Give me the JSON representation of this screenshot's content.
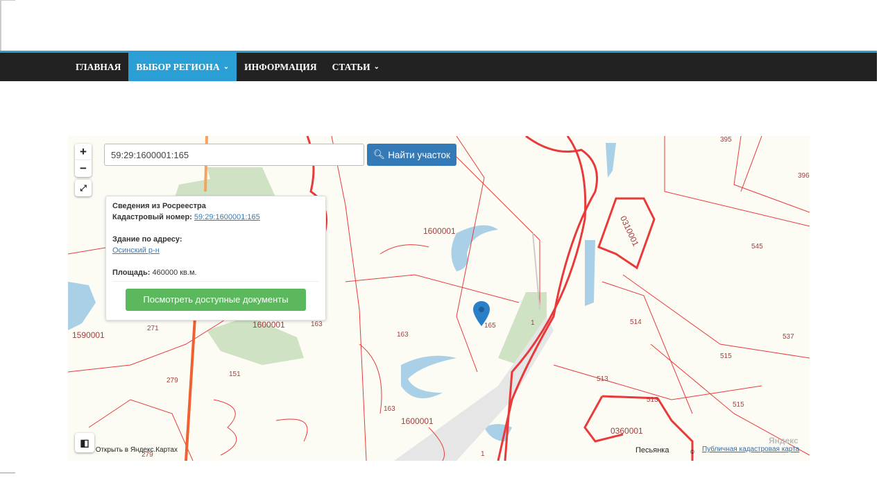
{
  "nav": {
    "items": [
      {
        "label": "ГЛАВНАЯ"
      },
      {
        "label": "ВЫБОР РЕГИОНА",
        "dropdown": true,
        "active": true
      },
      {
        "label": "ИНФОРМАЦИЯ"
      },
      {
        "label": "СТАТЬИ",
        "dropdown": true
      }
    ]
  },
  "map": {
    "search_value": "59:29:1600001:165",
    "find_button": "Найти участок",
    "zoom_in": "+",
    "zoom_out": "−",
    "popup": {
      "title": "Сведения из Росреестра",
      "cadastral_label": "Кадастровый номер:",
      "cadastral_value": "59:29:1600001:165",
      "address_label": "Здание по адресу:",
      "address_value": "Осинский р-н",
      "area_label": "Площадь:",
      "area_value": "460000 кв.м.",
      "docs_button": "Посмотреть доступные документы"
    },
    "labels": [
      "1600001",
      "1600001",
      "1600001",
      "1590001",
      "0310001",
      "0360001",
      "271",
      "279",
      "151",
      "163",
      "163",
      "163",
      "165",
      "1",
      "1",
      "395",
      "396",
      "545",
      "514",
      "537",
      "515",
      "515",
      "513",
      "513",
      "279"
    ],
    "place": "Песьянка",
    "open_yandex": "Открыть в Яндекс.Картах",
    "public_map_link": "Публичная кадастровая карта",
    "yandex_logo": "Яндекс",
    "colors": {
      "boundary": "#e83a3a",
      "water": "#a9d0e6",
      "forest": "#cfe3c4",
      "accent": "#2a9fd6"
    }
  }
}
